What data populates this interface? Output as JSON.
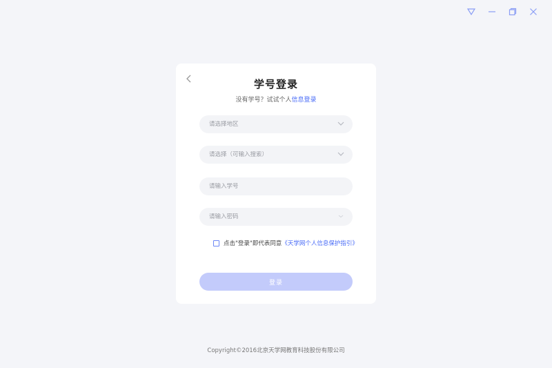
{
  "window": {
    "controls": [
      {
        "name": "dropdown-menu-icon"
      },
      {
        "name": "minimize-icon"
      },
      {
        "name": "restore-icon"
      },
      {
        "name": "close-icon"
      }
    ],
    "accent_color": "#8a9df5"
  },
  "login": {
    "title": "学号登录",
    "subtitle_prefix": "没有学号？试试个人",
    "subtitle_link": "信息登录",
    "region_placeholder": "请选择地区",
    "school_placeholder": "请选择（可输入搜索）",
    "student_id_placeholder": "请输入学号",
    "password_placeholder": "请输入密码",
    "agree_prefix": "点击\"登录\"即代表同意",
    "agree_link": "《天学网个人信息保护指引》",
    "login_button": "登录",
    "button_color": "#c3cbfb",
    "link_color": "#4a6cf7"
  },
  "footer": {
    "copyright": "Copyright©2016北京天学网教育科技股份有限公司"
  }
}
